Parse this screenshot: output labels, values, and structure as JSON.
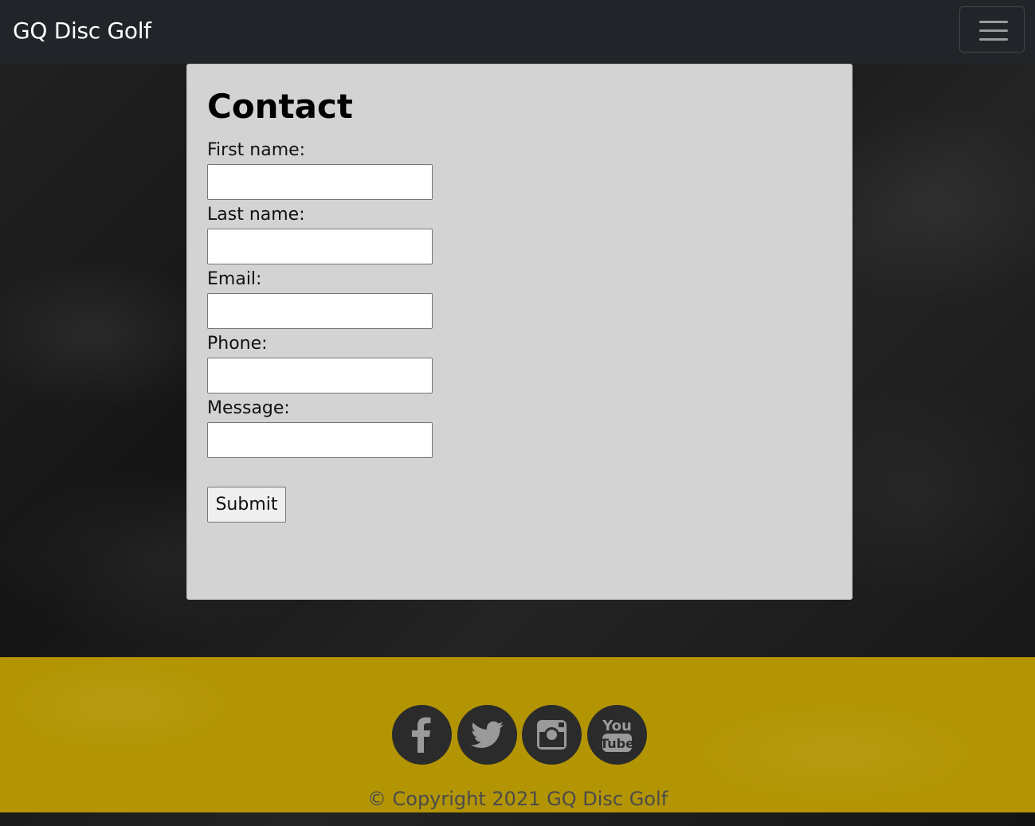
{
  "navbar": {
    "brand": "GQ Disc Golf",
    "toggler_icon": "hamburger-menu-icon"
  },
  "contact": {
    "title": "Contact",
    "fields": [
      {
        "label": "First name:",
        "value": "",
        "placeholder": ""
      },
      {
        "label": "Last name:",
        "value": "",
        "placeholder": ""
      },
      {
        "label": "Email:",
        "value": "",
        "placeholder": ""
      },
      {
        "label": "Phone:",
        "value": "",
        "placeholder": ""
      },
      {
        "label": "Message:",
        "value": "",
        "placeholder": ""
      }
    ],
    "submit_label": "Submit"
  },
  "footer": {
    "social": [
      {
        "name": "facebook-icon"
      },
      {
        "name": "twitter-icon"
      },
      {
        "name": "instagram-icon"
      },
      {
        "name": "youtube-icon",
        "text_top": "You",
        "text_bottom": "Tube"
      }
    ],
    "copyright": "© Copyright 2021 GQ Disc Golf"
  },
  "colors": {
    "navbar_bg": "#212529",
    "card_bg": "#d3d3d3",
    "footer_bg": "#b39504",
    "social_bg": "#2b2b2b",
    "social_fg": "#9a9a9a"
  }
}
